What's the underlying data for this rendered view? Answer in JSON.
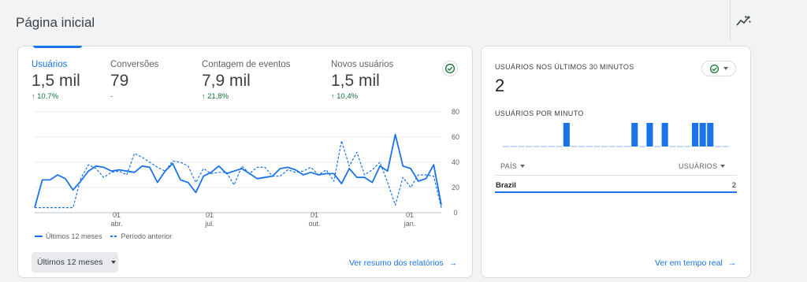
{
  "header": {
    "title": "Página inicial"
  },
  "metrics": [
    {
      "label": "Usuários",
      "value": "1,5 mil",
      "change": "10,7%",
      "arrow": "↑"
    },
    {
      "label": "Conversões",
      "value": "79",
      "change": "-",
      "arrow": ""
    },
    {
      "label": "Contagem de eventos",
      "value": "7,9 mil",
      "change": "21,8%",
      "arrow": "↑"
    },
    {
      "label": "Novos usuários",
      "value": "1,5 mil",
      "change": "10,4%",
      "arrow": "↑"
    }
  ],
  "chart_data": {
    "type": "line",
    "y_ticks": [
      "80",
      "60",
      "40",
      "20",
      "0"
    ],
    "ylim": [
      0,
      80
    ],
    "x_ticks": [
      {
        "day": "01",
        "month": "abr."
      },
      {
        "day": "01",
        "month": "jul."
      },
      {
        "day": "01",
        "month": "out."
      },
      {
        "day": "01",
        "month": "jan."
      }
    ],
    "grid": true,
    "legend_position": "bottom-left",
    "series": [
      {
        "name": "Últimos 12 meses",
        "style": "solid",
        "color": "#1a73e8",
        "values": [
          4,
          26,
          26,
          30,
          27,
          18,
          25,
          33,
          37,
          36,
          33,
          34,
          33,
          32,
          37,
          36,
          24,
          33,
          39,
          26,
          24,
          16,
          29,
          32,
          37,
          31,
          33,
          35,
          31,
          27,
          28,
          29,
          35,
          36,
          34,
          30,
          32,
          30,
          31,
          31,
          23,
          35,
          28,
          28,
          24,
          37,
          33,
          62,
          37,
          35,
          25,
          27,
          38,
          6
        ]
      },
      {
        "name": "Período anterior",
        "style": "dashed",
        "color": "#1a73e8",
        "values": [
          4,
          4,
          4,
          4,
          4,
          4,
          27,
          38,
          35,
          28,
          32,
          33,
          30,
          47,
          44,
          40,
          36,
          33,
          41,
          40,
          37,
          24,
          35,
          31,
          32,
          32,
          22,
          37,
          31,
          36,
          36,
          29,
          29,
          34,
          32,
          33,
          36,
          30,
          34,
          25,
          57,
          37,
          48,
          30,
          34,
          40,
          24,
          6,
          28,
          20,
          30,
          30,
          29,
          4
        ]
      }
    ]
  },
  "footer": {
    "range_label": "Últimos 12 meses",
    "link_label": "Ver resumo dos relatórios",
    "link_arrow": "→"
  },
  "realtime": {
    "title": "USUÁRIOS NOS ÚLTIMOS 30 MINUTOS",
    "value": "2",
    "per_minute_label": "USUÁRIOS POR MINUTO",
    "minute_bars": [
      0,
      0,
      0,
      0,
      0,
      0,
      0,
      0,
      1,
      0,
      0,
      0,
      0,
      0,
      0,
      0,
      0,
      1,
      0,
      1,
      0,
      1,
      0,
      0,
      0,
      1,
      1,
      1,
      0,
      0
    ],
    "col_country": "PAÍS",
    "col_users": "USUÁRIOS",
    "rows": [
      {
        "country": "Brazil",
        "users": "2"
      }
    ],
    "link_label": "Ver em tempo real",
    "link_arrow": "→"
  }
}
